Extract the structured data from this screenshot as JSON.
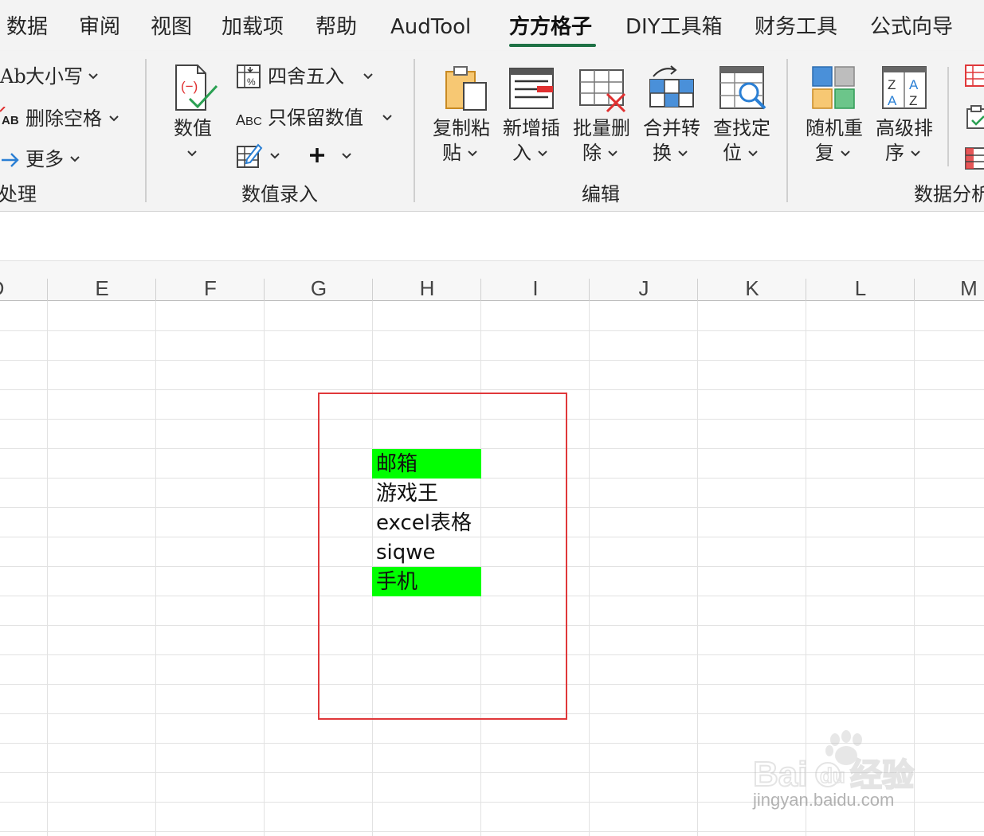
{
  "menu": {
    "tabs": [
      "数据",
      "审阅",
      "视图",
      "加载项",
      "帮助",
      "AudTool",
      "方方格子",
      "DIY工具箱",
      "财务工具",
      "公式向导"
    ],
    "active_tab": "方方格子"
  },
  "ribbon": {
    "text_group": {
      "case_label": "大小写",
      "trim_label": "删除空格",
      "more_label": "更多",
      "group_label": "处理"
    },
    "numeric_group": {
      "value_btn": "数值",
      "round_label": "四舍五入",
      "keep_numbers_label": "只保留数值",
      "group_label": "数值录入"
    },
    "edit_group": {
      "buttons": [
        {
          "l1": "复制粘",
          "l2": "贴"
        },
        {
          "l1": "新增插",
          "l2": "入"
        },
        {
          "l1": "批量删",
          "l2": "除"
        },
        {
          "l1": "合并转",
          "l2": "换"
        },
        {
          "l1": "查找定",
          "l2": "位"
        }
      ],
      "group_label": "编辑"
    },
    "analysis_group": {
      "buttons": [
        {
          "l1": "随机重",
          "l2": "复"
        },
        {
          "l1": "高级排",
          "l2": "序"
        }
      ],
      "group_label": "数据分析"
    }
  },
  "sheet": {
    "columns": [
      "D",
      "E",
      "F",
      "G",
      "H",
      "I",
      "J",
      "K",
      "L",
      "M"
    ],
    "cells": [
      {
        "text": "邮箱",
        "highlight": true
      },
      {
        "text": "游戏王",
        "highlight": false
      },
      {
        "text": "excel表格",
        "highlight": false
      },
      {
        "text": "siqwe",
        "highlight": false
      },
      {
        "text": "手机",
        "highlight": true
      }
    ],
    "highlight_color": "#00ff00",
    "annotation_box_color": "#e0383a"
  },
  "watermark": {
    "brand": "Baidu经验",
    "url": "jingyan.baidu.com"
  }
}
